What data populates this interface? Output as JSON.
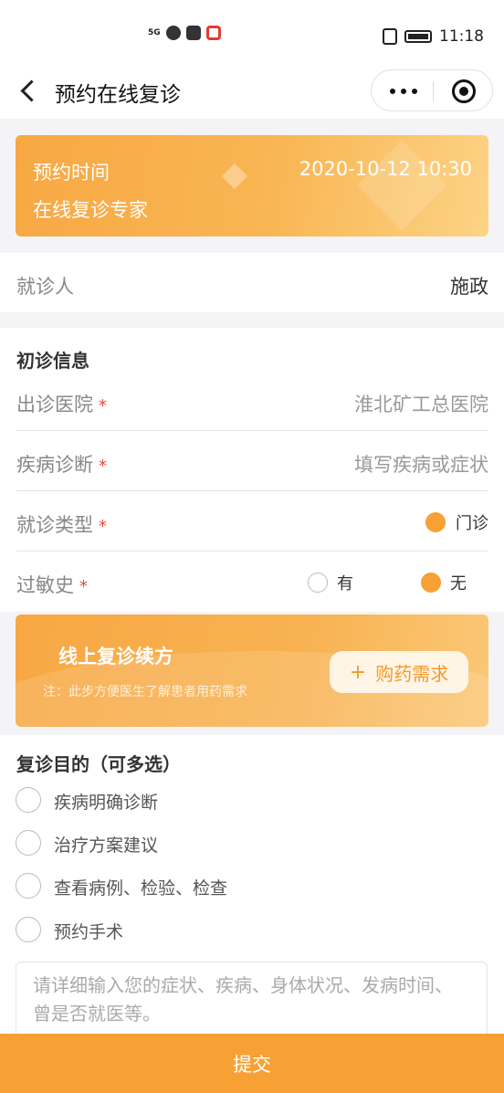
{
  "status_bar": {
    "network": "5G",
    "time": "11:18"
  },
  "nav": {
    "title": "预约在线复诊"
  },
  "banner": {
    "label": "预约时间",
    "datetime": "2020-10-12 10:30",
    "subtitle": "在线复诊专家"
  },
  "patient": {
    "label": "就诊人",
    "value": "施政"
  },
  "initial_info": {
    "title": "初诊信息",
    "required_mark": "*",
    "hospital": {
      "label": "出诊医院",
      "value": "淮北矿工总医院"
    },
    "diagnosis": {
      "label": "疾病诊断",
      "placeholder": "填写疾病或症状"
    },
    "visit_type": {
      "label": "就诊类型",
      "option": "门诊",
      "selected": true
    },
    "allergy": {
      "label": "过敏史",
      "options": [
        {
          "label": "有",
          "selected": false
        },
        {
          "label": "无",
          "selected": true
        }
      ]
    }
  },
  "refill": {
    "title": "线上复诊续方",
    "note": "注：此步方便医生了解患者用药需求",
    "button_label": "购药需求",
    "button_icon": "plus-icon"
  },
  "purpose": {
    "title": "复诊目的（可多选）",
    "options": [
      "疾病明确诊断",
      "治疗方案建议",
      "查看病例、检验、检查",
      "预约手术"
    ],
    "textarea_placeholder": "请详细输入您的症状、疾病、身体状况、发病时间、曾是否就医等。"
  },
  "submit_label": "提交",
  "colors": {
    "accent": "#f7a134",
    "required": "#e84b3c"
  }
}
